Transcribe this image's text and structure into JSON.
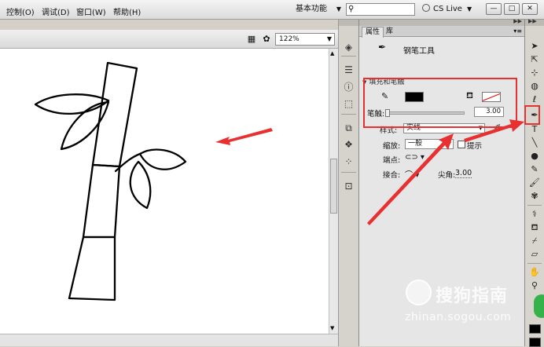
{
  "menubar": {
    "items": [
      "控制(O)",
      "调试(D)",
      "窗口(W)",
      "帮助(H)"
    ],
    "workspace": "基本功能",
    "search_placeholder": "",
    "cslive": "CS Live"
  },
  "editbar": {
    "zoom": "122%"
  },
  "panel": {
    "tabs": [
      "属性",
      "库"
    ],
    "tool_name": "钢笔工具",
    "section": "填充和笔触",
    "stroke_label": "笔触:",
    "stroke_value": "3.00",
    "style_label": "样式:",
    "style_value": "实线",
    "scale_label": "缩放:",
    "scale_value": "一般",
    "hint_label": "提示",
    "cap_label": "端点:",
    "join_label": "接合:",
    "miter_label": "尖角:",
    "miter_value": "3.00"
  },
  "watermark": {
    "brand": "搜狗指南",
    "url": "zhinan.sogou.com"
  },
  "colors": {
    "highlight": "#e83030",
    "stroke": "#000000",
    "fill": "none"
  }
}
